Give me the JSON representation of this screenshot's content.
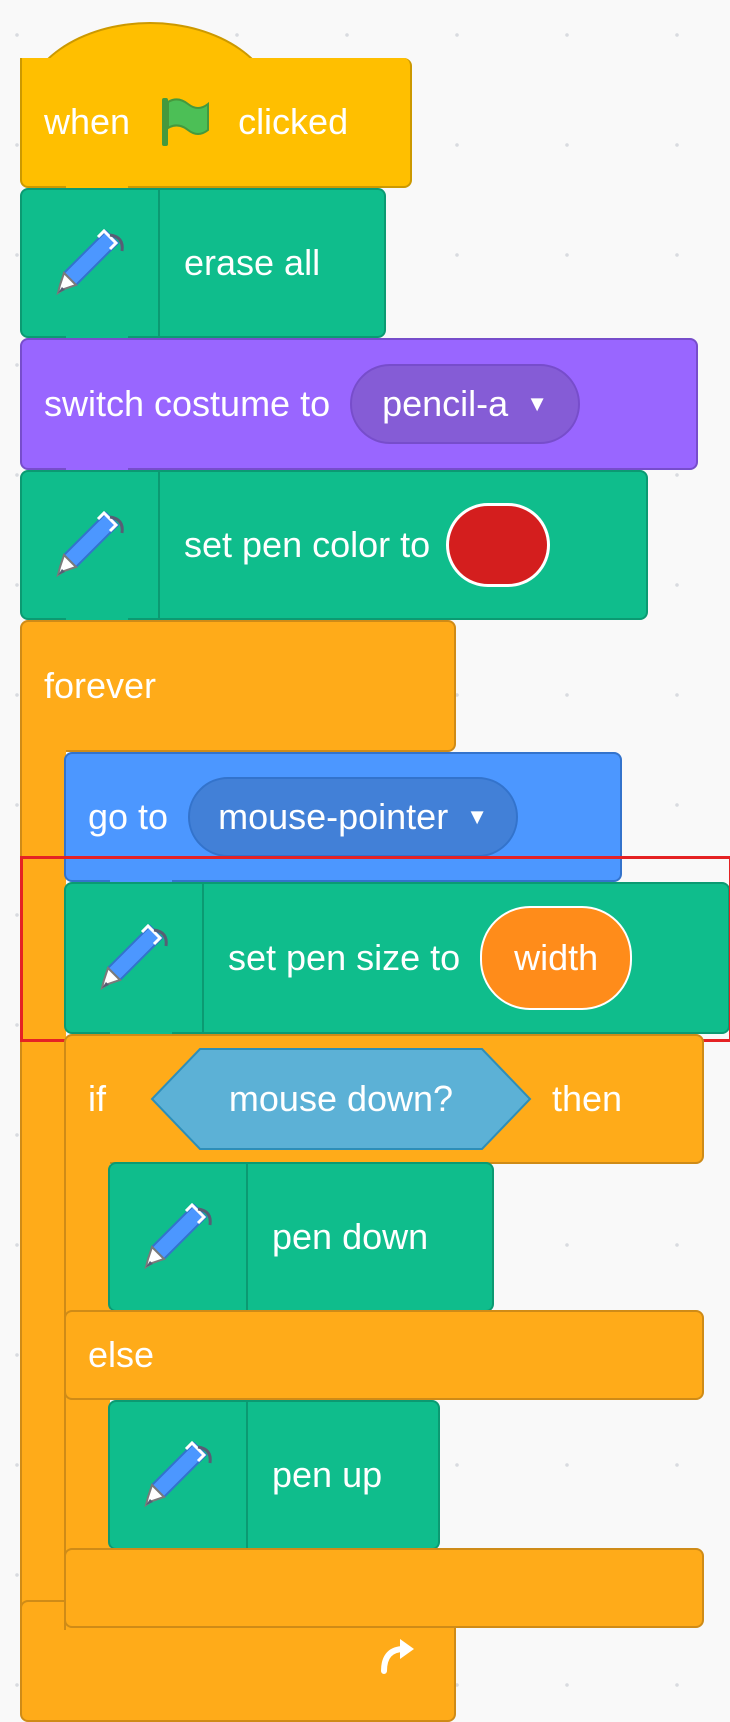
{
  "script": {
    "hat": {
      "prefix": "when",
      "flag_icon": "green-flag-icon",
      "suffix": "clicked"
    },
    "erase_all": {
      "label": "erase all",
      "icon": "pen-icon"
    },
    "switch_costume": {
      "label": "switch costume to",
      "costume": "pencil-a"
    },
    "set_color": {
      "label": "set pen color to",
      "color": "#d41e1e"
    },
    "forever": {
      "label": "forever",
      "loop_icon": "loop-arrow-icon"
    },
    "go_to": {
      "label": "go to",
      "target": "mouse-pointer"
    },
    "set_size": {
      "label": "set pen size to",
      "value": "width",
      "value_color": "#ff8c1a"
    },
    "if_else": {
      "if_label": "if",
      "condition": "mouse down?",
      "condition_color": "#5cb1d6",
      "then_label": "then",
      "else_label": "else"
    },
    "pen_down": {
      "label": "pen down"
    },
    "pen_up": {
      "label": "pen up"
    }
  },
  "colors": {
    "events": "#ffbf00",
    "pen": "#0fbd8c",
    "looks": "#9966ff",
    "motion": "#4c97ff",
    "control": "#ffab19",
    "highlight": "#e52224"
  }
}
